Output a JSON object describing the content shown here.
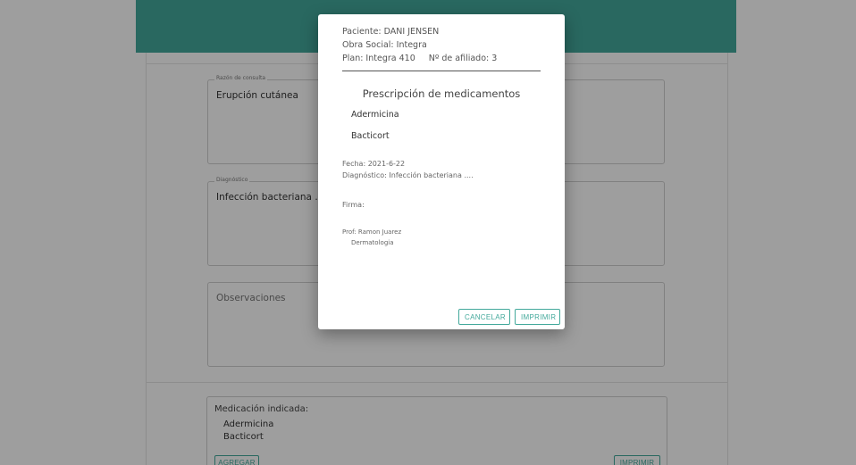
{
  "background": {
    "fields": {
      "consultation_reason": {
        "legend": "Razón de consulta",
        "value": "Erupción cutánea"
      },
      "diagnosis": {
        "legend": "Diagnóstico",
        "value": "Infección bacteriana ...."
      },
      "observations": {
        "placeholder": "Observaciones"
      }
    },
    "medication": {
      "title": "Medicación indicada:",
      "items": [
        "Adermicina",
        "Bacticort"
      ],
      "add_label": "AGREGAR",
      "print_label": "IMPRIMIR"
    },
    "colors": {
      "accent": "#43a99b"
    }
  },
  "dialog": {
    "patient_line": "Paciente: DANI JENSEN",
    "insurance_line": "Obra Social: Integra",
    "plan_line": "Plan: Integra 410",
    "affiliate_line": "Nº de afiliado: 3",
    "title": "Prescripción de medicamentos",
    "items": [
      "Adermicina",
      "Bacticort"
    ],
    "date_line": "Fecha: 2021-6-22",
    "diagnosis_line": "Diagnóstico: Infección bacteriana ....",
    "signature_label": "Firma:",
    "doctor_line": "Prof: Ramon Juarez",
    "specialty_line": "Dermatologia",
    "cancel_label": "CANCELAR",
    "print_label": "IMPRIMIR"
  }
}
